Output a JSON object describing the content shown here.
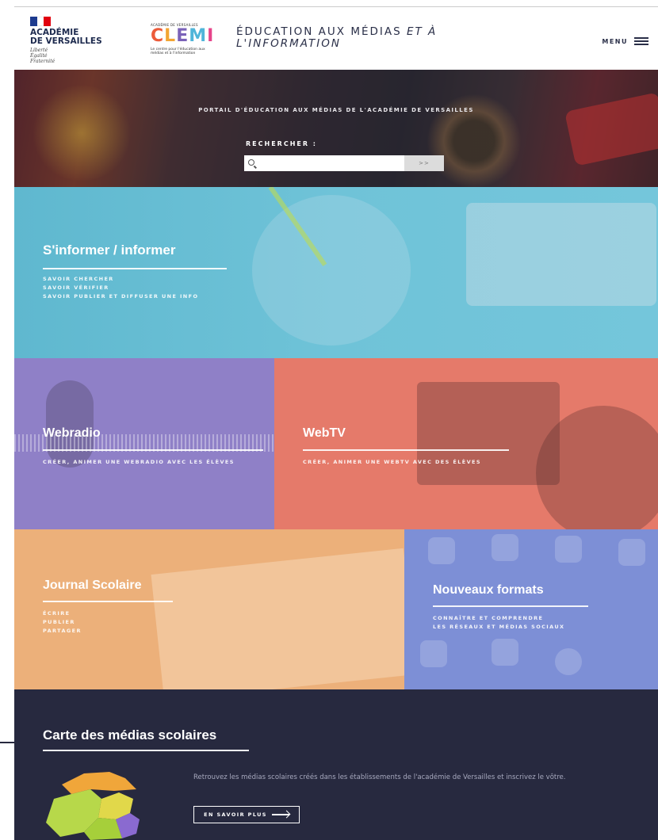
{
  "header": {
    "academie_name_line1": "ACADÉMIE",
    "academie_name_line2": "DE VERSAILLES",
    "motto": [
      "Liberté",
      "Égalité",
      "Fraternité"
    ],
    "clemi_top": "ACADÉMIE DE VERSAILLES",
    "clemi_logo": "CLEMI",
    "clemi_sub": "Le centre pour l'éducation aux médias et à l'information",
    "title_main": "ÉDUCATION AUX MÉDIAS ",
    "title_em1": "ET À",
    "title_em2": "L'INFORMATION",
    "menu_label": "MENU",
    "flag_colors": [
      "#1d3b8f",
      "#ffffff",
      "#e1000f"
    ]
  },
  "hero": {
    "tagline": "PORTAIL D'ÉDUCATION AUX MÉDIAS DE L'ACADÉMIE DE VERSAILLES",
    "search_label": "RECHERCHER :",
    "search_placeholder": "",
    "search_button": ">>"
  },
  "tiles": {
    "informer": {
      "title": "S'informer / informer",
      "links": [
        "SAVOIR CHERCHER",
        "SAVOIR VÉRIFIER",
        "SAVOIR PUBLIER ET DIFFUSER UNE INFO"
      ]
    },
    "webradio": {
      "title": "Webradio",
      "links": [
        "CRÉER, ANIMER UNE WEBRADIO AVEC LES ÉLÈVES"
      ]
    },
    "webtv": {
      "title": "WebTV",
      "links": [
        "CRÉER, ANIMER UNE WEBTV AVEC DES ÉLÈVES"
      ]
    },
    "journal": {
      "title": "Journal Scolaire",
      "links": [
        "ÉCRIRE",
        "PUBLIER",
        "PARTAGER"
      ]
    },
    "formats": {
      "title": "Nouveaux formats",
      "links": [
        "CONNAÎTRE ET COMPRENDRE",
        "LES RÉSEAUX ET MÉDIAS SOCIAUX"
      ]
    }
  },
  "carte": {
    "title": "Carte des médias scolaires",
    "text": "Retrouvez les médias scolaires créés dans les établissements de l'académie de Versailles et inscrivez le vôtre.",
    "button_label": "EN SAVOIR PLUS"
  }
}
